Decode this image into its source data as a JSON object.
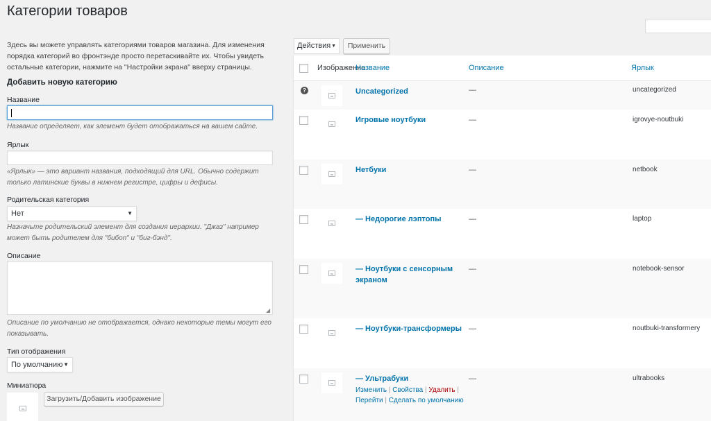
{
  "page": {
    "title": "Категории товаров"
  },
  "intro": "Здесь вы можете управлять категориями товаров магазина. Для изменения порядка категорий во фронтэнде просто перетаскивайте их. Чтобы увидеть остальные категории, нажмите на \"Настройки экрана\" вверху страницы.",
  "form": {
    "heading": "Добавить новую категорию",
    "name_label": "Название",
    "name_value": "",
    "name_desc": "Название определяет, как элемент будет отображаться на вашем сайте.",
    "slug_label": "Ярлык",
    "slug_value": "",
    "slug_desc": "«Ярлык» — это вариант названия, подходящий для URL. Обычно содержит только латинские буквы в нижнем регистре, цифры и дефисы.",
    "parent_label": "Родительская категория",
    "parent_value": "Нет",
    "parent_desc": "Назначьте родительский элемент для создания иерархии. \"Джаз\" например может быть родителем для \"бибоп\" и \"биг-бэнд\".",
    "description_label": "Описание",
    "description_desc": "Описание по умолчанию не отображается, однако некоторые темы могут его показывать.",
    "display_type_label": "Тип отображения",
    "display_type_value": "По умолчанию",
    "thumbnail_label": "Миниатюра",
    "upload_button": "Загрузить/Добавить изображение"
  },
  "bulk": {
    "actions_value": "Действия",
    "apply_label": "Применить"
  },
  "table": {
    "columns": {
      "image": "Изображение",
      "name": "Название",
      "description": "Описание",
      "slug": "Ярлык"
    },
    "rows": [
      {
        "name": "Uncategorized",
        "description": "—",
        "slug": "uncategorized"
      },
      {
        "name": "Игровые ноутбуки",
        "description": "—",
        "slug": "igrovye-noutbuki"
      },
      {
        "name": "Нетбуки",
        "description": "—",
        "slug": "netbook"
      },
      {
        "name": "— Недорогие лэптопы",
        "description": "—",
        "slug": "laptop"
      },
      {
        "name": "— Ноутбуки с сенсорным экраном",
        "description": "—",
        "slug": "notebook-sensor"
      },
      {
        "name": "— Ноутбуки-трансформеры",
        "description": "—",
        "slug": "noutbuki-transformery"
      },
      {
        "name": "— Ультрабуки",
        "description": "—",
        "slug": "ultrabooks"
      }
    ],
    "row_actions": {
      "edit": "Изменить",
      "properties": "Свойства",
      "delete": "Удалить",
      "view": "Перейти",
      "make_default": "Сделать по умолчанию",
      "separator": "|"
    }
  }
}
